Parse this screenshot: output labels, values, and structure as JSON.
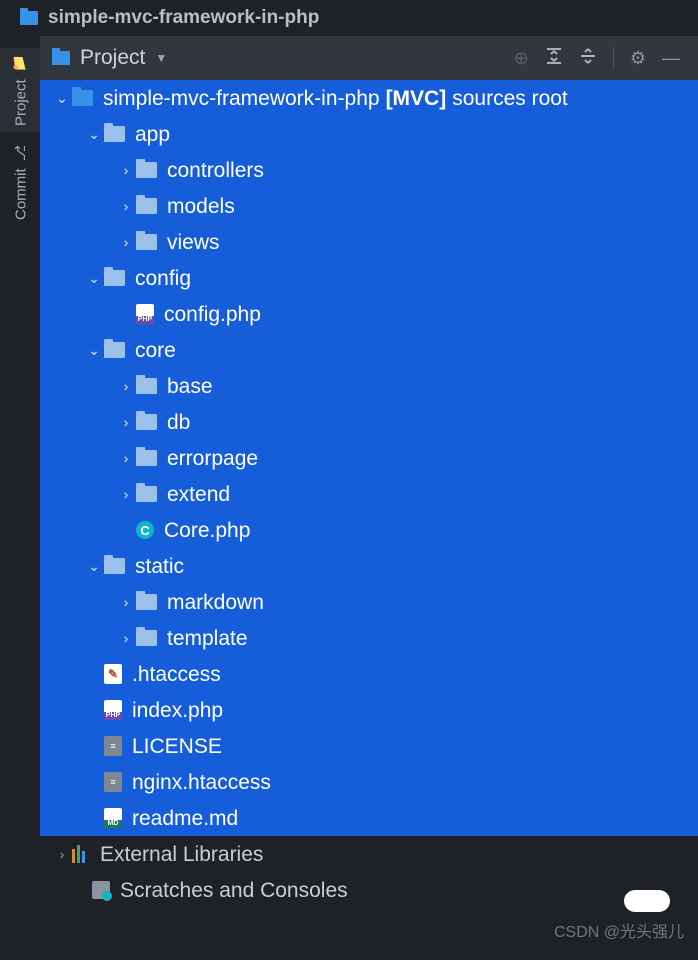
{
  "title": "simple-mvc-framework-in-php",
  "sidebar": {
    "tabs": [
      {
        "label": "Project",
        "icon": "📁",
        "active": true
      },
      {
        "label": "Commit",
        "icon": "⎇",
        "active": false
      }
    ]
  },
  "toolbar": {
    "title": "Project",
    "icons": {
      "target": "⊕",
      "expand": "⇱",
      "collapse": "⇲",
      "settings": "⚙",
      "hide": "—"
    }
  },
  "tree": {
    "root": {
      "name": "simple-mvc-framework-in-php",
      "tag": "[MVC]",
      "suffix": "sources root"
    },
    "nodes": [
      {
        "depth": 0,
        "type": "folder-root",
        "expanded": true,
        "label": "simple-mvc-framework-in-php",
        "sel": true
      },
      {
        "depth": 1,
        "type": "folder",
        "expanded": true,
        "label": "app",
        "sel": true
      },
      {
        "depth": 2,
        "type": "folder",
        "expanded": false,
        "label": "controllers",
        "sel": true
      },
      {
        "depth": 2,
        "type": "folder",
        "expanded": false,
        "label": "models",
        "sel": true
      },
      {
        "depth": 2,
        "type": "folder",
        "expanded": false,
        "label": "views",
        "sel": true
      },
      {
        "depth": 1,
        "type": "folder",
        "expanded": true,
        "label": "config",
        "sel": true
      },
      {
        "depth": 2,
        "type": "file-php",
        "label": "config.php",
        "sel": true
      },
      {
        "depth": 1,
        "type": "folder",
        "expanded": true,
        "label": "core",
        "sel": true
      },
      {
        "depth": 2,
        "type": "folder",
        "expanded": false,
        "label": "base",
        "sel": true
      },
      {
        "depth": 2,
        "type": "folder",
        "expanded": false,
        "label": "db",
        "sel": true
      },
      {
        "depth": 2,
        "type": "folder",
        "expanded": false,
        "label": "errorpage",
        "sel": true
      },
      {
        "depth": 2,
        "type": "folder",
        "expanded": false,
        "label": "extend",
        "sel": true
      },
      {
        "depth": 2,
        "type": "file-c",
        "label": "Core.php",
        "sel": true
      },
      {
        "depth": 1,
        "type": "folder",
        "expanded": true,
        "label": "static",
        "sel": true
      },
      {
        "depth": 2,
        "type": "folder",
        "expanded": false,
        "label": "markdown",
        "sel": true
      },
      {
        "depth": 2,
        "type": "folder",
        "expanded": false,
        "label": "template",
        "sel": true
      },
      {
        "depth": 1,
        "type": "file-ht",
        "label": ".htaccess",
        "sel": true
      },
      {
        "depth": 1,
        "type": "file-php",
        "label": "index.php",
        "sel": true
      },
      {
        "depth": 1,
        "type": "file-txt",
        "label": "LICENSE",
        "sel": true
      },
      {
        "depth": 1,
        "type": "file-txt",
        "label": "nginx.htaccess",
        "sel": true
      },
      {
        "depth": 1,
        "type": "file-md",
        "label": "readme.md",
        "sel": true
      },
      {
        "depth": 0,
        "type": "lib",
        "expanded": false,
        "label": "External Libraries",
        "sel": false
      },
      {
        "depth": 0,
        "type": "scratch",
        "label": "Scratches and Consoles",
        "sel": false
      }
    ]
  },
  "watermark": "CSDN @光头强儿"
}
